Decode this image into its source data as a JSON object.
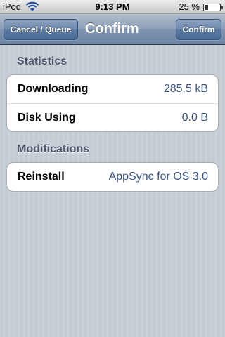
{
  "status_bar": {
    "carrier": "iPod",
    "time": "9:13 PM",
    "battery_percent_text": "25 %",
    "battery_level": 0.25,
    "wifi_icon": "wifi-icon"
  },
  "nav": {
    "title": "Confirm",
    "left_button": "Cancel / Queue",
    "right_button": "Confirm"
  },
  "sections": [
    {
      "header": "Statistics",
      "rows": [
        {
          "label": "Downloading",
          "value": "285.5 kB"
        },
        {
          "label": "Disk Using",
          "value": "0.0 B"
        }
      ]
    },
    {
      "header": "Modifications",
      "rows": [
        {
          "label": "Reinstall",
          "value": "AppSync for OS 3.0"
        }
      ]
    }
  ],
  "colors": {
    "nav_blue": "#6d84a2",
    "background": "#c5ccd4",
    "value_blue": "#385487",
    "section_header": "#4c566c"
  }
}
